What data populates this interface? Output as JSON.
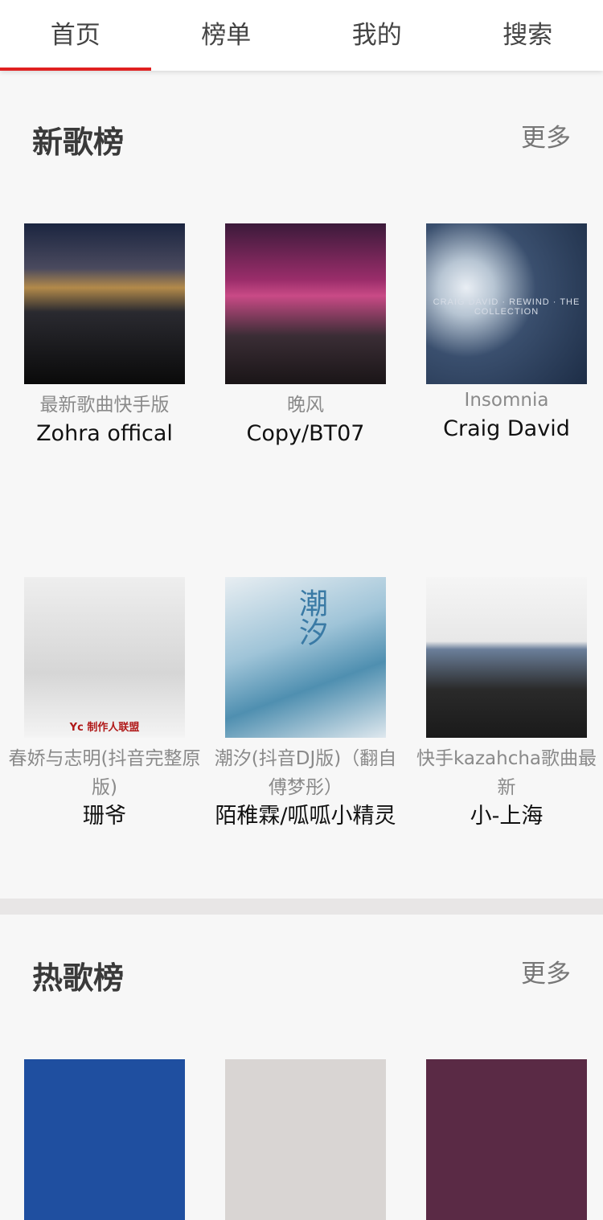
{
  "tabs": [
    {
      "label": "首页",
      "active": true
    },
    {
      "label": "榜单",
      "active": false
    },
    {
      "label": "我的",
      "active": false
    },
    {
      "label": "搜索",
      "active": false
    }
  ],
  "colors": {
    "accent": "#e02020",
    "background": "#f7f7f7"
  },
  "new_section": {
    "title": "新歌榜",
    "more": "更多",
    "items": [
      {
        "song": "最新歌曲快手版",
        "artist": "Zohra offical"
      },
      {
        "song": "晚风",
        "artist": "Copy/BT07"
      },
      {
        "song": "Insomnia",
        "artist": "Craig David",
        "cover_text": "CRAIG DAVID · REWIND · THE COLLECTION"
      },
      {
        "song": "春娇与志明(抖音完整原版)",
        "artist": "珊爷",
        "cover_text": "Yc 制作人联盟"
      },
      {
        "song": "潮汐(抖音DJ版)（翻自傅梦彤）",
        "artist": "陌稚霖/呱呱小精灵",
        "cover_text": "潮汐"
      },
      {
        "song": "快手kazahcha歌曲最新",
        "artist": "小-上海"
      }
    ]
  },
  "hot_section": {
    "title": "热歌榜",
    "more": "更多"
  }
}
